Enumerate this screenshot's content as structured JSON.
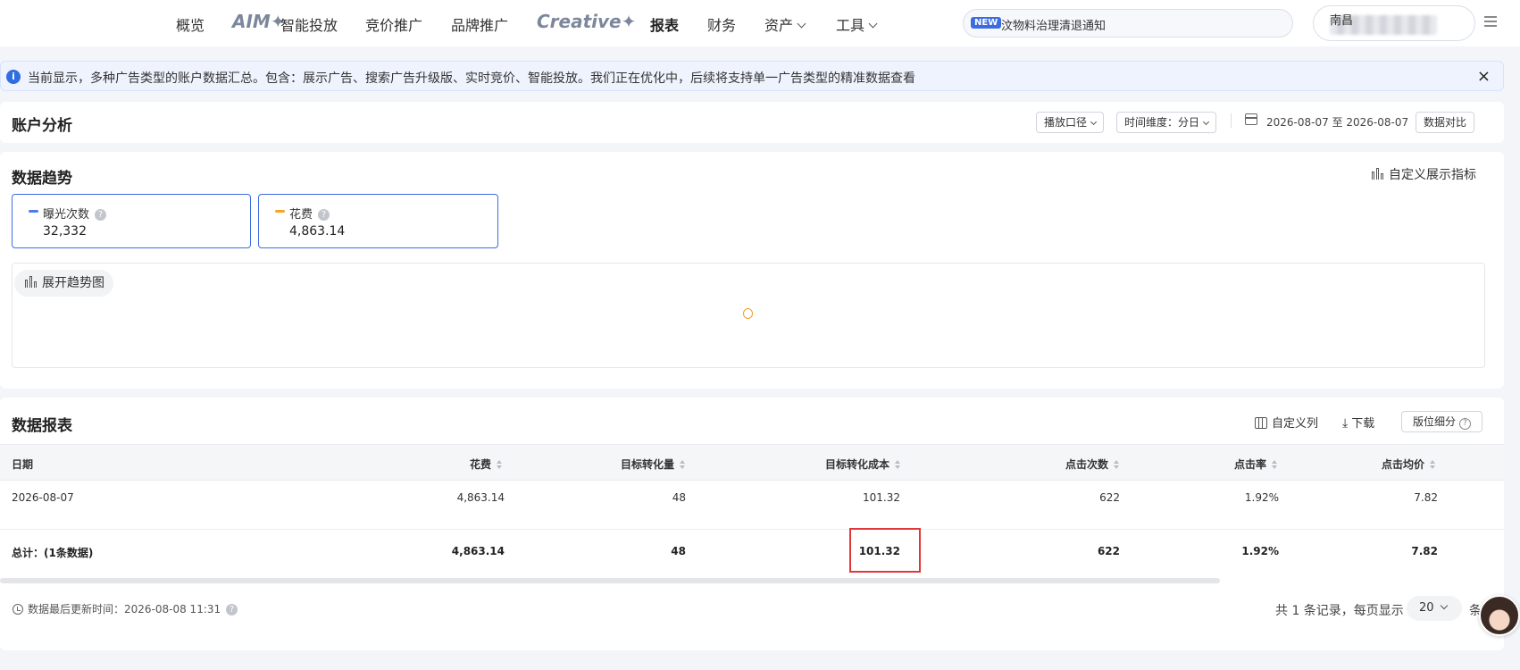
{
  "nav": {
    "items": [
      "概览",
      "AIM✦",
      "智能投放",
      "竞价推广",
      "品牌推广",
      "Creative✦",
      "报表",
      "财务",
      "资产",
      "工具"
    ],
    "notice_tag": "NEW",
    "notice_text": "汶物料治理清退通知",
    "user_name": "南昌"
  },
  "alert": {
    "icon": "info-icon",
    "text": "当前显示，多种广告类型的账户数据汇总。包含：展示广告、搜索广告升级版、实时竞价、智能投放。我们正在优化中，后续将支持单一广告类型的精准数据查看",
    "close": "×"
  },
  "account": {
    "title": "账户分析",
    "caliber_btn": "播放口径",
    "time_btn": "时间维度：分日",
    "date_range": "2026-08-07 至 2026-08-07",
    "compare_btn": "数据对比"
  },
  "trend": {
    "title": "数据趋势",
    "custom_metrics": "自定义展示指标",
    "cards": [
      {
        "label": "曝光次数",
        "value": "32,332",
        "color": "#4a7cf0"
      },
      {
        "label": "花费",
        "value": "4,863.14",
        "color": "#f5a623"
      }
    ],
    "expand_btn": "展开趋势图"
  },
  "report": {
    "title": "数据报表",
    "custom_cols": "自定义列",
    "download": "下载",
    "placement": "版位细分",
    "columns": [
      "日期",
      "花费",
      "目标转化量",
      "目标转化成本",
      "点击次数",
      "点击率",
      "点击均价"
    ],
    "rows": [
      [
        "2026-08-07",
        "4,863.14",
        "48",
        "101.32",
        "622",
        "1.92%",
        "7.82"
      ]
    ],
    "total": [
      "总计：(1条数据)",
      "4,863.14",
      "48",
      "101.32",
      "622",
      "1.92%",
      "7.82"
    ],
    "updated": "数据最后更新时间：2026-08-08 11:31",
    "pager_text": "共 1 条记录，每页显示",
    "page_size": "20",
    "pager_unit": "条"
  },
  "colors": {
    "accent": "#3d6ce0",
    "highlight": "#e0383a"
  }
}
